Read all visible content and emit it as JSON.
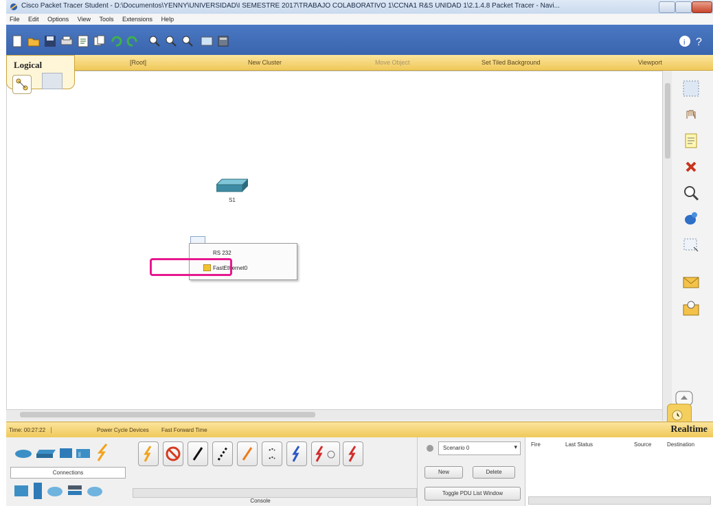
{
  "window": {
    "title": "Cisco Packet Tracer Student - D:\\Documentos\\YENNY\\UNIVERSIDAD\\I SEMESTRE 2017\\TRABAJO COLABORATIVO 1\\CCNA1 R&S UNIDAD 1\\2.1.4.8 Packet Tracer - Navi..."
  },
  "menu": [
    "File",
    "Edit",
    "Options",
    "View",
    "Tools",
    "Extensions",
    "Help"
  ],
  "logical_bar": {
    "tab": "Logical",
    "root": "[Root]",
    "new_cluster": "New Cluster",
    "move_object": "Move Object",
    "set_tiled_background": "Set Tiled Background",
    "viewport": "Viewport"
  },
  "canvas": {
    "device_label": "S1",
    "context_menu": [
      "RS 232",
      "FastEthernet0"
    ]
  },
  "status": {
    "time": "Time: 00:27:22",
    "power_cycle": "Power Cycle Devices",
    "fast_forward": "Fast Forward Time",
    "mode": "Realtime"
  },
  "bottom": {
    "connections_label": "Connections",
    "console_label": "Console",
    "scenario": "Scenario 0",
    "new": "New",
    "delete": "Delete",
    "toggle_pdu": "Toggle PDU List Window",
    "pdu_columns": [
      "Fire",
      "Last Status",
      "Source",
      "Destination"
    ]
  },
  "colors": {
    "toolbar_blue": "#3a64ae",
    "logical_yellow": "#f0c95a",
    "highlight_pink": "#e6178e"
  }
}
